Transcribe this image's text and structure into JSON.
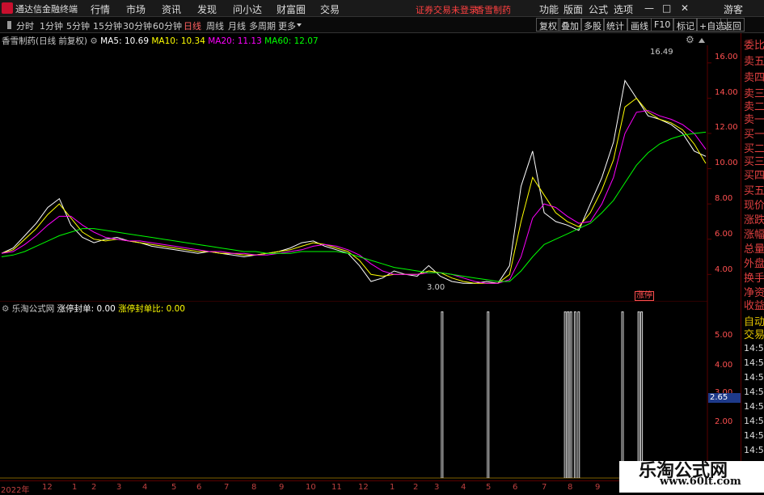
{
  "app": {
    "title": "通达信金融终端",
    "notice": "证券交易未登录",
    "stock_name": "香雪制药"
  },
  "menu": [
    "行情",
    "市场",
    "资讯",
    "发现",
    "问小达",
    "财富圈",
    "交易"
  ],
  "right_menu": [
    "功能",
    "版面",
    "公式",
    "选项"
  ],
  "window_controls": [
    "—",
    "□",
    "✕"
  ],
  "guest": "游客",
  "period_tabs": [
    "分时",
    "1分钟",
    "5分钟",
    "15分钟",
    "30分钟",
    "60分钟",
    "日线",
    "周线",
    "月线",
    "多周期",
    "更多"
  ],
  "active_period": "日线",
  "toolbar_buttons": [
    "复权",
    "叠加",
    "多股",
    "统计",
    "画线",
    "F10",
    "标记",
    "+自选",
    "返回"
  ],
  "main_title": "香雪制药(日线 前复权)",
  "ma": [
    {
      "label": "MA5: 10.69",
      "color": "#ffffff"
    },
    {
      "label": "MA10: 10.34",
      "color": "#ffff00"
    },
    {
      "label": "MA20: 11.13",
      "color": "#ff00ff"
    },
    {
      "label": "MA60: 12.07",
      "color": "#00ff00"
    }
  ],
  "sub_title": "乐淘公式网",
  "sub_values": [
    {
      "label": "涨停封单: 0.00",
      "color": "#ffffff"
    },
    {
      "label": "涨停封单比: 0.00",
      "color": "#ffff00"
    }
  ],
  "main_y_ticks": [
    "16.00",
    "14.00",
    "12.00",
    "10.00",
    "8.00",
    "6.00",
    "4.00"
  ],
  "sub_y_ticks": [
    "5.00",
    "4.00",
    "3.00",
    "2.00"
  ],
  "sub_marker": "2.65",
  "high_label": "16.49",
  "low_label": "3.00",
  "limit_label": "涨停",
  "x_ticks": [
    "2022年",
    "12",
    "1",
    "2",
    "3",
    "4",
    "5",
    "6",
    "7",
    "8",
    "9",
    "10",
    "11",
    "12",
    "1",
    "2",
    "3",
    "4",
    "5",
    "6",
    "7",
    "8",
    "9"
  ],
  "right_panel": [
    "委比",
    "卖五",
    "卖四",
    "卖三",
    "卖二",
    "卖一",
    "买一",
    "买二",
    "买三",
    "买四",
    "买五",
    "现价",
    "涨跌",
    "涨幅",
    "总量",
    "外盘",
    "换手",
    "净资",
    "收益"
  ],
  "right_panel_lower": [
    "自动",
    "交易",
    "14:56",
    "14:56",
    "14:56",
    "14:56",
    "14:56",
    "14:56",
    "14:56",
    "14:56"
  ],
  "watermark": {
    "title": "乐淘公式网",
    "url": "www.60lt.com"
  },
  "chart_data": {
    "type": "line",
    "title": "香雪制药(日线 前复权)",
    "ylim": [
      2.5,
      17
    ],
    "series": [
      {
        "name": "MA5",
        "color": "#ffffff",
        "values": [
          5.2,
          5.5,
          6.2,
          6.9,
          7.8,
          8.3,
          6.8,
          6.1,
          5.8,
          6.0,
          6.1,
          5.9,
          5.8,
          5.6,
          5.5,
          5.4,
          5.3,
          5.2,
          5.3,
          5.2,
          5.1,
          5.0,
          5.1,
          5.2,
          5.3,
          5.5,
          5.8,
          5.9,
          5.6,
          5.4,
          5.2,
          4.5,
          3.6,
          3.8,
          4.2,
          4.0,
          3.9,
          4.5,
          3.9,
          3.6,
          3.5,
          3.5,
          3.6,
          3.5,
          4.5,
          9.0,
          11.0,
          7.5,
          7.0,
          6.8,
          6.5,
          8.0,
          9.5,
          11.5,
          15.0,
          14.0,
          13.0,
          12.8,
          12.5,
          12.0,
          11.0,
          10.7
        ]
      },
      {
        "name": "MA10",
        "color": "#ffff00",
        "values": [
          5.2,
          5.4,
          6.0,
          6.6,
          7.4,
          8.0,
          7.2,
          6.4,
          6.0,
          5.9,
          6.0,
          5.9,
          5.8,
          5.7,
          5.6,
          5.5,
          5.4,
          5.3,
          5.3,
          5.2,
          5.2,
          5.1,
          5.1,
          5.2,
          5.3,
          5.4,
          5.6,
          5.8,
          5.7,
          5.5,
          5.3,
          4.8,
          4.0,
          3.9,
          4.0,
          4.0,
          4.0,
          4.2,
          4.1,
          3.8,
          3.6,
          3.5,
          3.5,
          3.5,
          4.0,
          7.0,
          9.5,
          8.5,
          7.5,
          7.0,
          6.7,
          7.5,
          8.8,
          10.5,
          13.5,
          14.0,
          13.2,
          12.8,
          12.6,
          12.2,
          11.4,
          10.3
        ]
      },
      {
        "name": "MA20",
        "color": "#ff00ff",
        "values": [
          5.2,
          5.3,
          5.7,
          6.2,
          6.8,
          7.3,
          7.3,
          6.8,
          6.4,
          6.1,
          6.0,
          5.9,
          5.9,
          5.8,
          5.7,
          5.6,
          5.5,
          5.4,
          5.3,
          5.3,
          5.2,
          5.2,
          5.1,
          5.1,
          5.2,
          5.3,
          5.4,
          5.6,
          5.7,
          5.6,
          5.4,
          5.1,
          4.6,
          4.2,
          4.0,
          4.0,
          4.0,
          4.1,
          4.1,
          4.0,
          3.8,
          3.6,
          3.5,
          3.5,
          3.7,
          5.0,
          7.2,
          8.0,
          7.8,
          7.3,
          6.9,
          7.0,
          8.0,
          9.5,
          12.0,
          13.2,
          13.3,
          13.0,
          12.8,
          12.5,
          12.0,
          11.1
        ]
      },
      {
        "name": "MA60",
        "color": "#00ff00",
        "values": [
          5.0,
          5.1,
          5.3,
          5.6,
          5.9,
          6.2,
          6.4,
          6.6,
          6.6,
          6.5,
          6.4,
          6.3,
          6.2,
          6.1,
          6.0,
          5.9,
          5.8,
          5.7,
          5.6,
          5.5,
          5.4,
          5.3,
          5.3,
          5.2,
          5.2,
          5.2,
          5.3,
          5.3,
          5.3,
          5.3,
          5.2,
          5.0,
          4.8,
          4.6,
          4.4,
          4.3,
          4.2,
          4.1,
          4.1,
          4.0,
          3.9,
          3.8,
          3.7,
          3.6,
          3.6,
          4.2,
          5.0,
          5.7,
          6.0,
          6.3,
          6.6,
          6.9,
          7.5,
          8.2,
          9.2,
          10.2,
          10.9,
          11.4,
          11.7,
          11.9,
          12.0,
          12.07
        ]
      }
    ],
    "sub_chart": {
      "type": "bar",
      "ylim": [
        0,
        5.8
      ],
      "spike_positions": [
        0.625,
        0.69,
        0.799,
        0.803,
        0.807,
        0.813,
        0.818,
        0.88,
        0.903,
        0.907
      ],
      "spike_value": 5.7
    }
  }
}
